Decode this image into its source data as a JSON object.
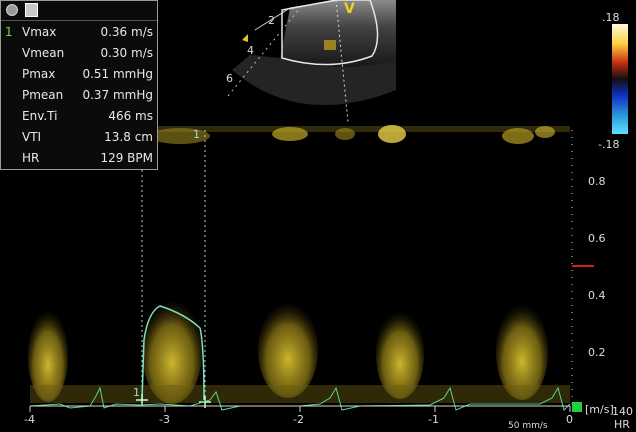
{
  "measurements": {
    "index": "1",
    "rows": [
      {
        "name": "Vmax",
        "value": "0.36 m/s"
      },
      {
        "name": "Vmean",
        "value": "0.30 m/s"
      },
      {
        "name": "Pmax",
        "value": "0.51 mmHg"
      },
      {
        "name": "Pmean",
        "value": "0.37 mmHg"
      },
      {
        "name": "Env.Ti",
        "value": "466 ms"
      },
      {
        "name": "VTI",
        "value": "13.8 cm"
      },
      {
        "name": "HR",
        "value": "129 BPM"
      }
    ]
  },
  "color_bar": {
    "top": ".18",
    "bottom": "-.18"
  },
  "probe": {
    "marker": "V",
    "depths": [
      "2",
      "4",
      "6"
    ]
  },
  "spectral": {
    "velocity_ticks": [
      "0.8",
      "0.6",
      "0.4",
      "0.2"
    ],
    "velocity_unit": "[m/s]",
    "time_ticks": [
      "-4",
      "-3",
      "-2",
      "-1",
      "0"
    ],
    "sweep_speed": "50 mm/s",
    "hr_scale": "140",
    "hr_label": "HR",
    "cursor_label": "1",
    "trace_label": "1"
  },
  "colors": {
    "doppler": "#c9b42a",
    "trace": "#7fe0c0",
    "ecg": "#5bd58a",
    "baseline_marker": "#d22020"
  }
}
